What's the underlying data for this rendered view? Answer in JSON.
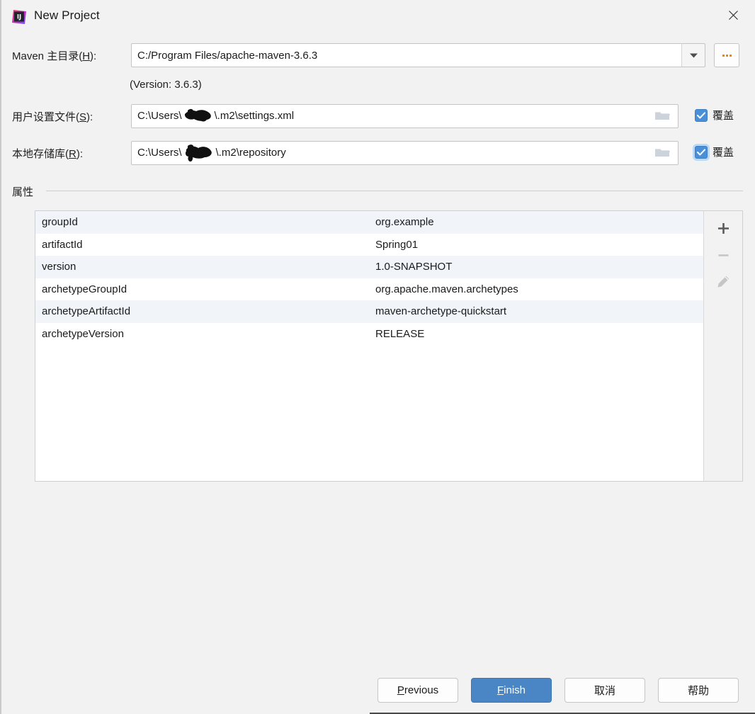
{
  "window": {
    "title": "New Project",
    "app_icon": "intellij-idea-logo",
    "close_icon": "close-icon"
  },
  "fields": {
    "maven_home": {
      "label_prefix": "Maven 主目录(",
      "label_mnemonic": "H",
      "label_suffix": "):",
      "value": "C:/Program Files/apache-maven-3.6.3",
      "version_note": "(Version: 3.6.3)",
      "dropdown_icon": "chevron-down-icon",
      "browse_label": "...",
      "browse_icon": "ellipsis-icon"
    },
    "user_settings_file": {
      "label_prefix": "用户设置文件(",
      "label_mnemonic": "S",
      "label_suffix": "):",
      "value": "C:\\Users\\███\\.m2\\settings.xml",
      "value_prefix": "C:\\Users\\",
      "value_suffix": "\\.m2\\settings.xml",
      "folder_icon": "folder-icon",
      "override_label": "覆盖",
      "override_checked": true
    },
    "local_repository": {
      "label_prefix": "本地存储库(",
      "label_mnemonic": "R",
      "label_suffix": "):",
      "value": "C:\\Users\\███\\.m2\\repository",
      "value_prefix": "C:\\Users\\",
      "value_suffix": "\\.m2\\repository",
      "folder_icon": "folder-icon",
      "override_label": "覆盖",
      "override_checked": true
    }
  },
  "properties_section": {
    "title": "属性",
    "rows": [
      {
        "key": "groupId",
        "value": "org.example"
      },
      {
        "key": "artifactId",
        "value": "Spring01"
      },
      {
        "key": "version",
        "value": "1.0-SNAPSHOT"
      },
      {
        "key": "archetypeGroupId",
        "value": "org.apache.maven.archetypes"
      },
      {
        "key": "archetypeArtifactId",
        "value": "maven-archetype-quickstart"
      },
      {
        "key": "archetypeVersion",
        "value": "RELEASE"
      }
    ],
    "toolbar": {
      "add_icon": "plus-icon",
      "remove_icon": "minus-icon",
      "edit_icon": "pencil-icon"
    }
  },
  "footer": {
    "previous_prefix": "",
    "previous_mnemonic": "P",
    "previous_suffix": "revious",
    "finish_mnemonic": "F",
    "finish_suffix": "inish",
    "cancel_label": "取消",
    "help_label": "帮助"
  },
  "colors": {
    "dialog_bg": "#f2f2f2",
    "accent": "#4a86c5",
    "checkbox": "#4a90d9",
    "row_alt": "#f1f5fa",
    "field_border": "#c4c4c4"
  }
}
